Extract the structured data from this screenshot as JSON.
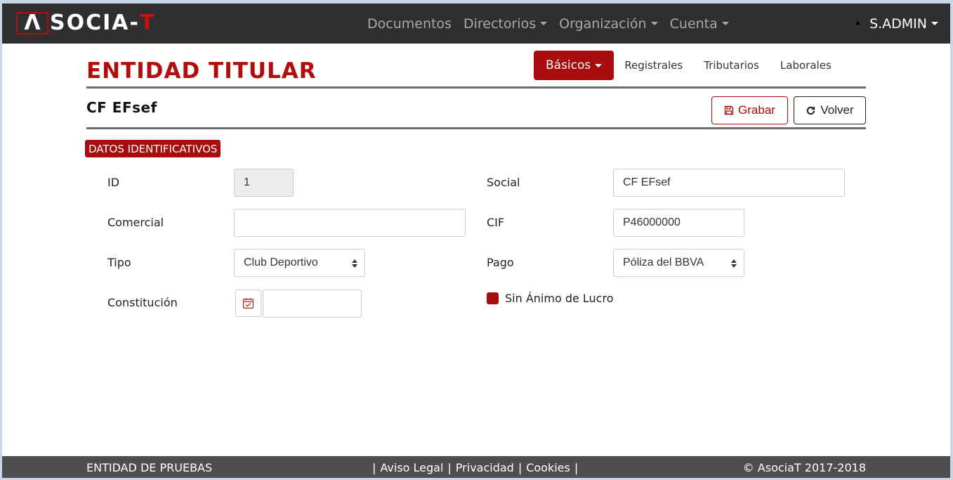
{
  "navbar": {
    "logo_box": "Λ",
    "logo_text": "SOCIA-",
    "logo_t": "T",
    "menu": [
      {
        "label": "Documentos",
        "dropdown": false
      },
      {
        "label": "Directorios",
        "dropdown": true
      },
      {
        "label": "Organización",
        "dropdown": true
      },
      {
        "label": "Cuenta",
        "dropdown": true
      }
    ],
    "user": "S.ADMIN"
  },
  "page": {
    "title": "ENTIDAD TITULAR",
    "tabs": [
      {
        "label": "Básicos",
        "active": true
      },
      {
        "label": "Registrales",
        "active": false
      },
      {
        "label": "Tributarios",
        "active": false
      },
      {
        "label": "Laborales",
        "active": false
      }
    ],
    "entity_name": "CF EFsef",
    "save_label": "Grabar",
    "back_label": "Volver",
    "section": "DATOS IDENTIFICATIVOS"
  },
  "form": {
    "id_label": "ID",
    "id_value": "1",
    "comercial_label": "Comercial",
    "comercial_value": "",
    "tipo_label": "Tipo",
    "tipo_value": "Club Deportivo",
    "constitucion_label": "Constitución",
    "constitucion_value": "",
    "social_label": "Social",
    "social_value": "CF EFsef",
    "cif_label": "CIF",
    "cif_value": "P46000000",
    "pago_label": "Pago",
    "pago_value": "Póliza del BBVA",
    "sin_animo_label": "Sin Ánimo de Lucro",
    "sin_animo_checked": true
  },
  "footer": {
    "left": "ENTIDAD DE PRUEBAS",
    "links": [
      "Aviso Legal",
      "Privacidad",
      "Cookies"
    ],
    "sep": "|",
    "copyright": "© AsociaT 2017-2018"
  },
  "colors": {
    "brand": "#a80c0c",
    "navbar": "#2f2f31",
    "footer": "#4e4e50"
  }
}
